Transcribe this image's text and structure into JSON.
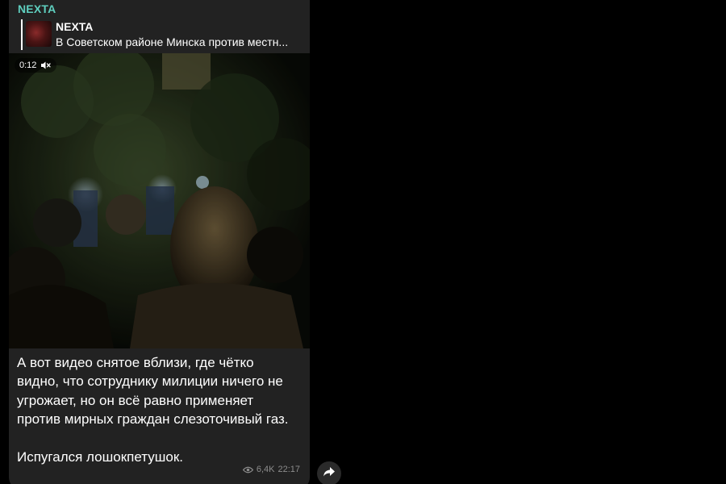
{
  "channel": {
    "name": "NEXTA",
    "name_color": "#5fcfbf"
  },
  "reply": {
    "title": "NEXTA",
    "text": "В Советском районе Минска против местн..."
  },
  "video": {
    "duration": "0:12",
    "muted": true,
    "mute_icon": "speaker-muted-icon"
  },
  "message": {
    "paragraph1": "А вот видео снятое вблизи, где чётко видно, что сотруднику милиции ничего не угрожает, но он всё равно применяет против мирных граждан слезоточивый газ.",
    "paragraph2": "Испугался лошокпетушок."
  },
  "meta": {
    "views": "6,4K",
    "time": "22:17",
    "views_icon": "eye-icon"
  },
  "share": {
    "icon": "share-arrow-icon"
  },
  "colors": {
    "background": "#000000",
    "bubble": "#222222",
    "meta_text": "#8d8d8d"
  }
}
